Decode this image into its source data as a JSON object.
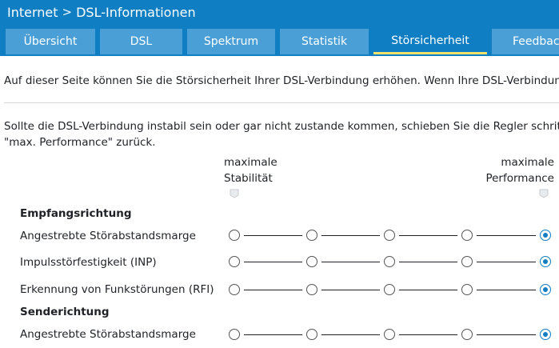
{
  "breadcrumb": {
    "parent": "Internet",
    "separator": ">",
    "current": "DSL-Informationen"
  },
  "tabs": [
    {
      "label": "Übersicht",
      "active": false
    },
    {
      "label": "DSL",
      "active": false
    },
    {
      "label": "Spektrum",
      "active": false
    },
    {
      "label": "Statistik",
      "active": false
    },
    {
      "label": "Störsicherheit",
      "active": true
    },
    {
      "label": "Feedback",
      "active": false
    }
  ],
  "intro_text": "Auf dieser Seite können Sie die Störsicherheit Ihrer DSL-Verbindung erhöhen. Wenn Ihre DSL-Verbindung",
  "instruction_line1": "Sollte die DSL-Verbindung instabil sein oder gar nicht zustande kommen, schieben Sie die Regler schrittw",
  "instruction_line2": "\"max. Performance\" zurück.",
  "scale_labels": {
    "left_line1": "maximale",
    "left_line2": "Stabilität",
    "right_line1": "maximale",
    "right_line2": "Performance"
  },
  "sections": {
    "receive_title": "Empfangsrichtung",
    "send_title": "Senderichtung"
  },
  "rows": [
    {
      "label": "Angestrebte Störabstandsmarge",
      "selected": 4
    },
    {
      "label": "Impulsstörfestigkeit (INP)",
      "selected": 4
    },
    {
      "label": "Erkennung von Funkstörungen (RFI)",
      "selected": 4
    },
    {
      "label": "Angestrebte Störabstandsmarge",
      "selected": 4
    }
  ],
  "colors": {
    "header": "#0f7ec3",
    "tab": "#4a9fd6",
    "active_tab_underline": "#f2e36c",
    "selected_radio": "#0f7ec3"
  }
}
